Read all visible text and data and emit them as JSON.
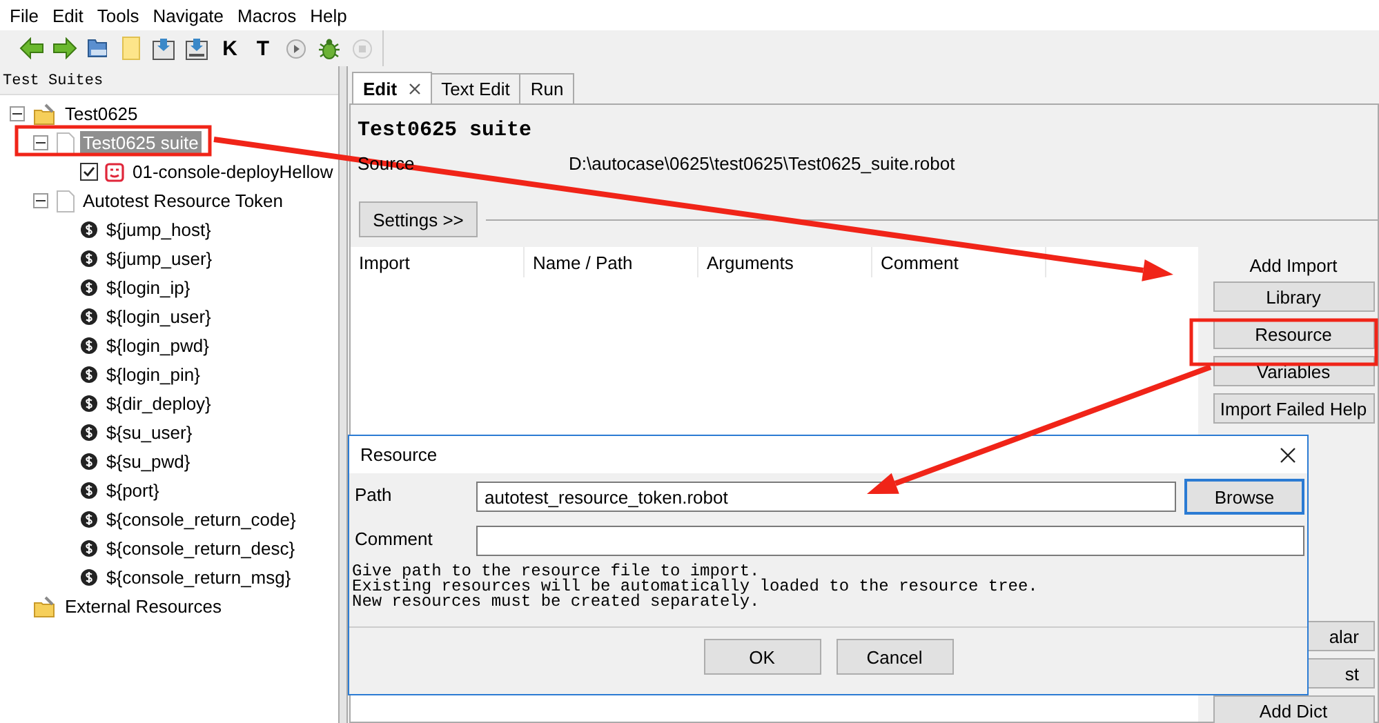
{
  "menu": [
    "File",
    "Edit",
    "Tools",
    "Navigate",
    "Macros",
    "Help"
  ],
  "toolbar": [
    {
      "kind": "back"
    },
    {
      "kind": "forward"
    },
    {
      "kind": "open"
    },
    {
      "kind": "new"
    },
    {
      "kind": "save"
    },
    {
      "kind": "save_all"
    },
    {
      "kind": "glyph",
      "label": "K"
    },
    {
      "kind": "glyph",
      "label": "T"
    },
    {
      "kind": "run"
    },
    {
      "kind": "debug"
    },
    {
      "kind": "stop"
    }
  ],
  "tree_panel": {
    "title": "Test Suites",
    "items": [
      {
        "label": "Test0625",
        "kind": "project",
        "selected": false,
        "expanded": true,
        "children": [
          {
            "label": "Test0625 suite",
            "kind": "file",
            "selected": true,
            "expanded": true,
            "children": [
              {
                "label": "01-console-deployHellow",
                "kind": "test",
                "selected": false,
                "checked": true
              }
            ]
          },
          {
            "label": "Autotest Resource Token",
            "kind": "file",
            "selected": false,
            "expanded": true,
            "children": [
              {
                "label": "${jump_host}",
                "kind": "variable",
                "selected": false
              },
              {
                "label": "${jump_user}",
                "kind": "variable",
                "selected": false
              },
              {
                "label": "${login_ip}",
                "kind": "variable",
                "selected": false
              },
              {
                "label": "${login_user}",
                "kind": "variable",
                "selected": false
              },
              {
                "label": "${login_pwd}",
                "kind": "variable",
                "selected": false
              },
              {
                "label": "${login_pin}",
                "kind": "variable",
                "selected": false
              },
              {
                "label": "${dir_deploy}",
                "kind": "variable",
                "selected": false
              },
              {
                "label": "${su_user}",
                "kind": "variable",
                "selected": false
              },
              {
                "label": "${su_pwd}",
                "kind": "variable",
                "selected": false
              },
              {
                "label": "${port}",
                "kind": "variable",
                "selected": false
              },
              {
                "label": "${console_return_code}",
                "kind": "variable",
                "selected": false
              },
              {
                "label": "${console_return_desc}",
                "kind": "variable",
                "selected": false
              },
              {
                "label": "${console_return_msg}",
                "kind": "variable",
                "selected": false
              }
            ]
          }
        ]
      },
      {
        "label": "External Resources",
        "kind": "project",
        "selected": false
      }
    ]
  },
  "tabs": [
    {
      "label": "Edit",
      "selected": true,
      "closable": true
    },
    {
      "label": "Text Edit",
      "selected": false,
      "closable": false
    },
    {
      "label": "Run",
      "selected": false,
      "closable": false
    }
  ],
  "editor": {
    "title": "Test0625 suite",
    "source_label": "Source",
    "source_path": "D:\\autocase\\0625\\test0625\\Test0625_suite.robot",
    "settings_button": "Settings >>",
    "table": {
      "columns": [
        "Import",
        "Name / Path",
        "Arguments",
        "Comment"
      ]
    },
    "side_label": "Add Import",
    "side_buttons": [
      {
        "label": "Library",
        "kind": "top"
      },
      {
        "label": "Resource",
        "kind": "top"
      },
      {
        "label": "Variables",
        "kind": "top"
      },
      {
        "label": "Import Failed Help",
        "kind": "top"
      },
      {
        "label": "alar",
        "kind": "cut"
      },
      {
        "label": "st",
        "kind": "cut"
      },
      {
        "label": "Add Dict",
        "kind": "bottom"
      }
    ]
  },
  "dialog": {
    "title": "Resource",
    "fields": [
      {
        "label": "Path",
        "value": "autotest_resource_token.robot",
        "button": "Browse"
      },
      {
        "label": "Comment"
      }
    ],
    "help_lines": [
      "Give path to the resource file to import.",
      "Existing resources will be automatically loaded to the resource tree.",
      "New resources must be created separately."
    ],
    "buttons": [
      "OK",
      "Cancel"
    ]
  }
}
